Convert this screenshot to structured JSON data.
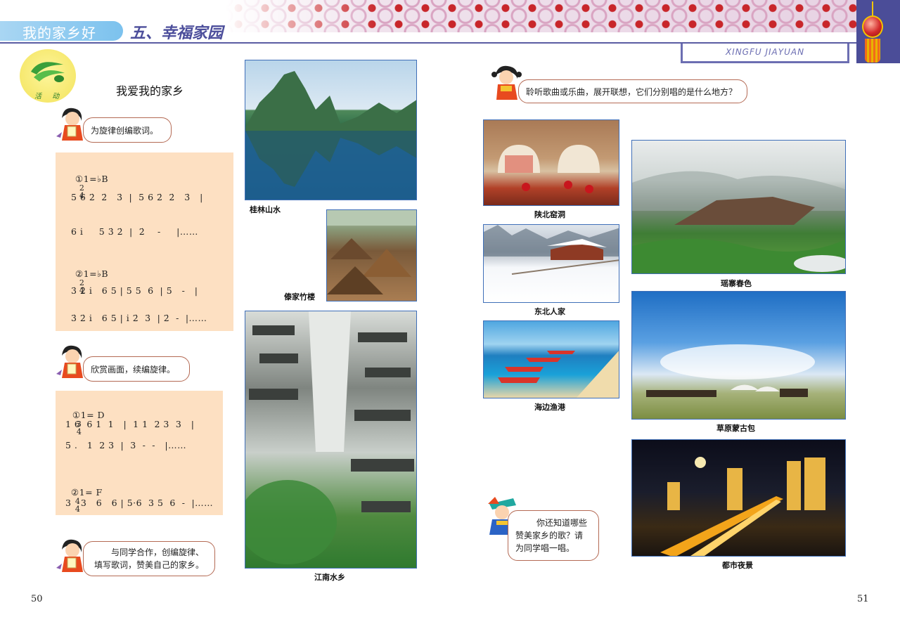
{
  "header": {
    "unit_title": "我的家乡好",
    "lesson_title": "五、幸福家园",
    "pinyin": "XINGFU  JIAYUAN"
  },
  "activity": {
    "badge_label": "活 动",
    "title": "我爱我的家乡"
  },
  "prompts": {
    "lyrics": "为旋律创编歌词。",
    "melody": "欣赏画面，续编旋律。",
    "cooperate_line1": "与同学合作，创编旋律、",
    "cooperate_line2": "填写歌词，赞美自己的家乡。",
    "listen": "聆听歌曲或乐曲，展开联想，它们分别唱的是什么地方？",
    "sing_line1": "你还知道哪些",
    "sing_line2": "赞美家乡的歌？请",
    "sing_line3": "为同学唱一唱。"
  },
  "score1": {
    "key1": "①1=♭B",
    "ts1_top": "2",
    "ts1_bottom": "4",
    "row1": "5 6 2̇  2̇   3̇  |  5 6 2̇  2̇   3̇   |",
    "row2": "6 i̇     5 3̇ 2̇  |  2̇    -     |……",
    "key2": "②1=♭B",
    "ts2_top": "2",
    "ts2_bottom": "4",
    "row3": "3̇ 2̇ i̇   6 5 | 5 5  6̇  | 5   -   |",
    "row4": "3̇ 2̇ i̇   6 5 | i̇ 2̇  3̇  | 2̇  -  |……"
  },
  "score2": {
    "key1": "①1= D",
    "ts1_top": "3",
    "ts1_bottom": "4",
    "row1": "1 6  6 1  1   |  1 1  2 3  3   |",
    "row2": "5 .   1  2 3  |  3  -  -   |……",
    "key2": "②1= F",
    "ts2_top": "4",
    "ts2_bottom": "4",
    "row3": "3   3   6   6 | 5·6  3 5  6  -  |……"
  },
  "photos": {
    "guilin": "桂林山水",
    "dai": "傣家竹楼",
    "jiangnan": "江南水乡",
    "shanbei": "陕北窑洞",
    "dongbei": "东北人家",
    "haibian": "海边渔港",
    "yaozhai": "瑶寨春色",
    "caoyuan": "草原蒙古包",
    "dushi": "都市夜景"
  },
  "page_numbers": {
    "left": "50",
    "right": "51"
  },
  "colors": {
    "header_blue": "#7cc2ee",
    "title_purple": "#4c4e9b",
    "score_panel": "#fde0c2",
    "photo_border": "#3f6fb8"
  }
}
